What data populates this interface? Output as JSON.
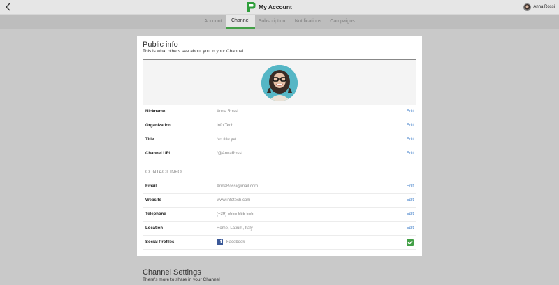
{
  "header": {
    "title": "My Account",
    "user_name": "Anna Rossi",
    "brand_color": "#43a047"
  },
  "tabs": [
    {
      "label": "Account",
      "active": false
    },
    {
      "label": "Channel",
      "active": true
    },
    {
      "label": "Subscription",
      "active": false
    },
    {
      "label": "Notifications",
      "active": false
    },
    {
      "label": "Campaigns",
      "active": false
    }
  ],
  "public_info": {
    "title": "Public info",
    "subtitle": "This is what others see about you in your Channel",
    "edit_label": "Edit",
    "fields": [
      {
        "label": "Nickname",
        "value": "Anna Rossi"
      },
      {
        "label": "Organization",
        "value": "Info Tech"
      },
      {
        "label": "Title",
        "value": "No title yet"
      },
      {
        "label": "Channel URL",
        "value": "/@AnnaRossi"
      }
    ],
    "contact_heading": "CONTACT INFO",
    "contact_fields": [
      {
        "label": "Email",
        "value": "AnnaRossi@mail.com"
      },
      {
        "label": "Website",
        "value": "www.infotech.com"
      },
      {
        "label": "Telephone",
        "value": "(+39) 5555 555 555"
      },
      {
        "label": "Location",
        "value": "Rome, Latium, Italy"
      }
    ],
    "social": {
      "label": "Social Profiles",
      "network": "Facebook",
      "icon": "facebook-icon",
      "checked": true
    }
  },
  "channel_settings": {
    "title": "Channel Settings",
    "subtitle": "There's more to share in your Channel"
  }
}
